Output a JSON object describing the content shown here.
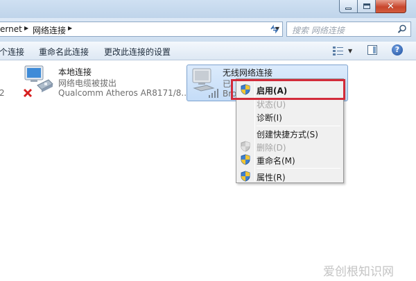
{
  "window": {
    "minimize_icon": "minimize-icon",
    "maximize_icon": "maximize-icon",
    "close_icon": "close-icon"
  },
  "address": {
    "crumbs": [
      "ernet",
      "网络连接"
    ],
    "search_placeholder": "搜索 网络连接"
  },
  "toolbar": {
    "items": [
      "个连接",
      "重命名此连接",
      "更改此连接的设置"
    ]
  },
  "connections": [
    {
      "name": "本地连接",
      "status": "网络电缆被拔出",
      "adapter": "Qualcomm Atheros AR8171/8...",
      "left_edge_text": "2"
    },
    {
      "name": "无线网络连接",
      "status": "已",
      "adapter": "Bro"
    }
  ],
  "context_menu": {
    "items": [
      {
        "label": "启用(A)",
        "bold": true,
        "icon": "shield-icon",
        "disabled": false
      },
      {
        "label": "状态(U)",
        "bold": false,
        "icon": "",
        "disabled": true
      },
      {
        "label": "诊断(I)",
        "bold": false,
        "icon": "",
        "disabled": false
      },
      {
        "label": "创建快捷方式(S)",
        "bold": false,
        "icon": "",
        "disabled": false
      },
      {
        "label": "删除(D)",
        "bold": false,
        "icon": "shield-icon",
        "disabled": true
      },
      {
        "label": "重命名(M)",
        "bold": false,
        "icon": "shield-icon",
        "disabled": false
      },
      {
        "label": "属性(R)",
        "bold": false,
        "icon": "shield-icon",
        "disabled": false
      }
    ]
  },
  "colors": {
    "highlight_box": "#d22b3a",
    "selection": "#c4dcf7"
  },
  "watermark": "爱创根知识网"
}
